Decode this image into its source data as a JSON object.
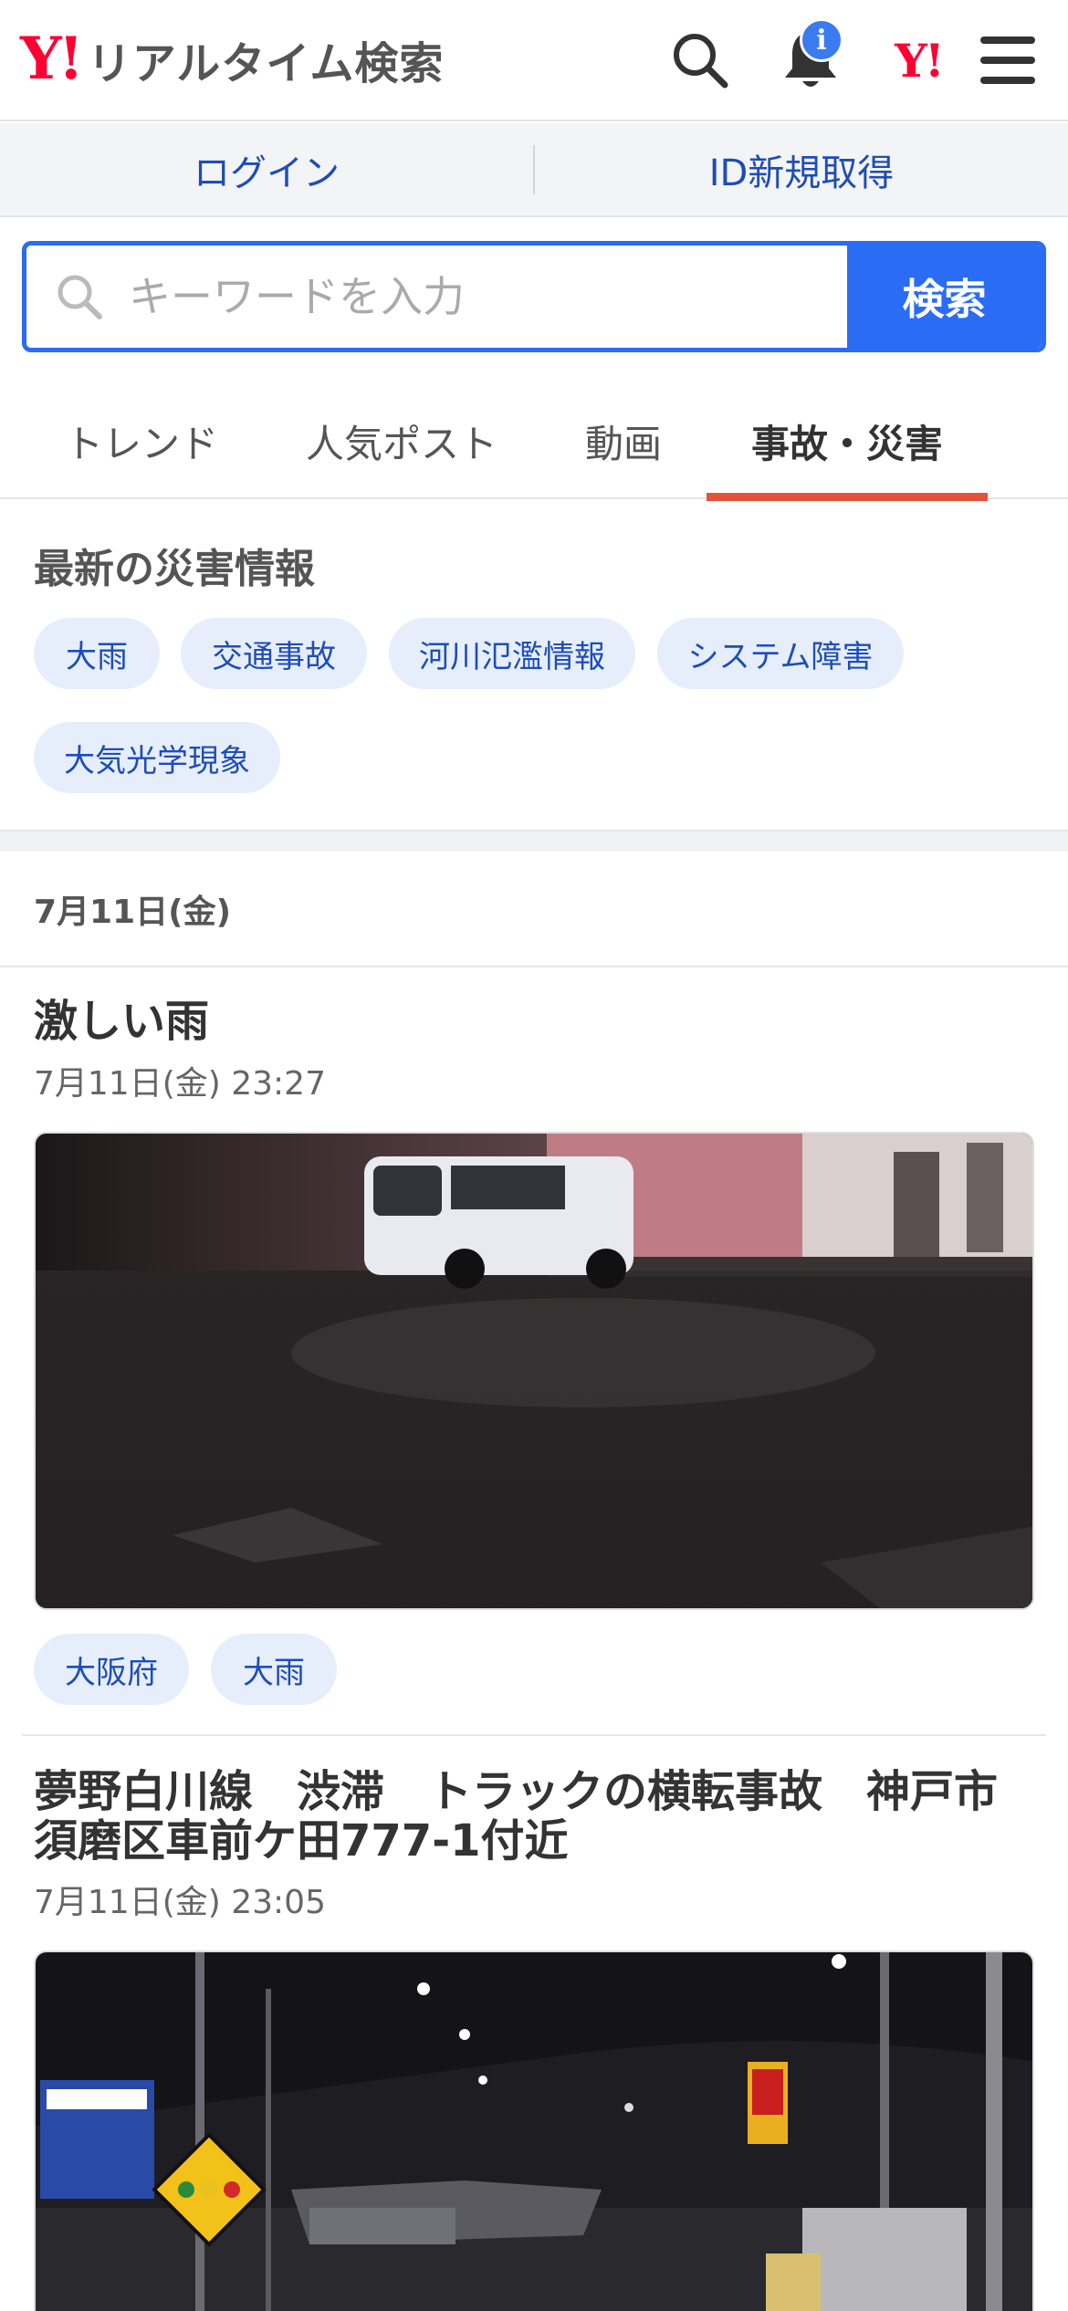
{
  "header": {
    "logo_mark": "Y!",
    "logo_text": "リアルタイム検索",
    "notification_badge": "i",
    "yahoo_mark": "Y!"
  },
  "account": {
    "login": "ログイン",
    "register": "ID新規取得"
  },
  "search": {
    "placeholder": "キーワードを入力",
    "value": "",
    "button": "検索"
  },
  "tabs": [
    {
      "label": "トレンド",
      "active": false
    },
    {
      "label": "人気ポスト",
      "active": false
    },
    {
      "label": "動画",
      "active": false
    },
    {
      "label": "事故・災害",
      "active": true
    }
  ],
  "disaster": {
    "title": "最新の災害情報",
    "chips": [
      "大雨",
      "交通事故",
      "河川氾濫情報",
      "システム障害",
      "大気光学現象"
    ]
  },
  "date_header": "7月11日(金)",
  "posts": [
    {
      "title": "激しい雨",
      "time": "7月11日(金) 23:27",
      "image": "night rain street with white van",
      "tags": [
        "大阪府",
        "大雨"
      ]
    },
    {
      "title": "夢野白川線　渋滞　トラックの横転事故　神戸市須磨区車前ケ田777-1付近",
      "time": "7月11日(金) 23:05",
      "image": "overturned truck on road at night"
    }
  ],
  "colors": {
    "brand_red": "#ff0033",
    "accent_blue": "#2a6df4",
    "link_blue": "#1e4db7",
    "tab_underline": "#e2533a",
    "chip_bg": "#e6eefc"
  }
}
